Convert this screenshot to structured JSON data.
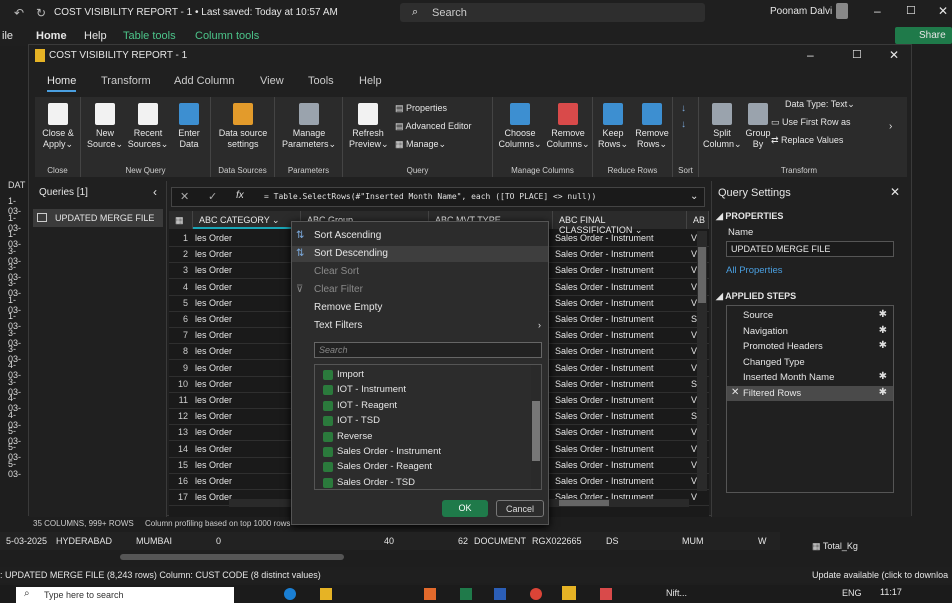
{
  "excel": {
    "title": "COST VISIBILITY REPORT - 1 • Last saved: Today at 10:57 AM",
    "search": "Search",
    "user": "Poonam Dalvi",
    "menu": [
      "ile",
      "Home",
      "Help",
      "Table tools",
      "Column tools"
    ],
    "share": "Share"
  },
  "pq": {
    "title": "COST VISIBILITY REPORT - 1",
    "tabs": [
      "Home",
      "Transform",
      "Add Column",
      "View",
      "Tools",
      "Help"
    ]
  },
  "ribbon": {
    "close": [
      "Close &",
      "Apply"
    ],
    "close_group": "Close",
    "new_source": [
      "New",
      "Source"
    ],
    "recent": [
      "Recent",
      "Sources"
    ],
    "enter": [
      "Enter",
      "Data"
    ],
    "newq_group": "New Query",
    "ds": [
      "Data source",
      "settings"
    ],
    "ds_group": "Data Sources",
    "params": [
      "Manage",
      "Parameters"
    ],
    "params_group": "Parameters",
    "refresh": [
      "Refresh",
      "Preview"
    ],
    "properties": "Properties",
    "adv": "Advanced Editor",
    "manage": "Manage",
    "query_group": "Query",
    "choose": [
      "Choose",
      "Columns"
    ],
    "remove": [
      "Remove",
      "Columns"
    ],
    "mc_group": "Manage Columns",
    "keep": [
      "Keep",
      "Rows"
    ],
    "remrows": [
      "Remove",
      "Rows"
    ],
    "rr_group": "Reduce Rows",
    "sort_group": "Sort",
    "split": [
      "Split",
      "Column"
    ],
    "group": [
      "Group",
      "By"
    ],
    "dtype": "Data Type: Text",
    "firstrow": "Use First Row as",
    "replace": "Replace Values",
    "transform_group": "Transform"
  },
  "queries": {
    "title": "Queries [1]",
    "item": "UPDATED MERGE FILE"
  },
  "formula": "= Table.SelectRows(#\"Inserted Month Name\", each ([TO PLACE] <> null))",
  "columns": {
    "category": "CATEGORY",
    "group": "Group",
    "mvt": "MVT TYPE",
    "final": "FINAL CLASSIFICATION"
  },
  "rows": [
    {
      "n": "1",
      "a": "les Order",
      "b": "Sales Order - Instrument",
      "c": "V"
    },
    {
      "n": "2",
      "a": "les Order",
      "b": "Sales Order - Instrument",
      "c": "V"
    },
    {
      "n": "3",
      "a": "les Order",
      "b": "Sales Order - Instrument",
      "c": "V"
    },
    {
      "n": "4",
      "a": "les Order",
      "b": "Sales Order - Instrument",
      "c": "V"
    },
    {
      "n": "5",
      "a": "les Order",
      "b": "Sales Order - Instrument",
      "c": "V"
    },
    {
      "n": "6",
      "a": "les Order",
      "b": "Sales Order - Instrument",
      "c": "S"
    },
    {
      "n": "7",
      "a": "les Order",
      "b": "Sales Order - Instrument",
      "c": "V"
    },
    {
      "n": "8",
      "a": "les Order",
      "b": "Sales Order - Instrument",
      "c": "V"
    },
    {
      "n": "9",
      "a": "les Order",
      "b": "Sales Order - Instrument",
      "c": "V"
    },
    {
      "n": "10",
      "a": "les Order",
      "b": "Sales Order - Instrument",
      "c": "S"
    },
    {
      "n": "11",
      "a": "les Order",
      "b": "Sales Order - Instrument",
      "c": "V"
    },
    {
      "n": "12",
      "a": "les Order",
      "b": "Sales Order - Instrument",
      "c": "S"
    },
    {
      "n": "13",
      "a": "les Order",
      "b": "Sales Order - Instrument",
      "c": "V"
    },
    {
      "n": "14",
      "a": "les Order",
      "b": "Sales Order - Instrument",
      "c": "V"
    },
    {
      "n": "15",
      "a": "les Order",
      "b": "Sales Order - Instrument",
      "c": "V"
    },
    {
      "n": "16",
      "a": "les Order",
      "b": "Sales Order - Instrument",
      "c": "V"
    },
    {
      "n": "17",
      "a": "les Order",
      "b": "Sales Order - Instrument",
      "c": "V"
    }
  ],
  "dropdown": {
    "sort_asc": "Sort Ascending",
    "sort_desc": "Sort Descending",
    "clear_sort": "Clear Sort",
    "clear_filter": "Clear Filter",
    "remove_empty": "Remove Empty",
    "text_filters": "Text Filters",
    "search": "Search",
    "values": [
      "Import",
      "IOT - Instrument",
      "IOT - Reagent",
      "IOT - TSD",
      "Reverse",
      "Sales Order - Instrument",
      "Sales Order - Reagent",
      "Sales Order - TSD"
    ],
    "ok": "OK",
    "cancel": "Cancel"
  },
  "settings": {
    "title": "Query Settings",
    "properties": "PROPERTIES",
    "name_label": "Name",
    "name": "UPDATED MERGE FILE",
    "all": "All Properties",
    "steps_title": "APPLIED STEPS",
    "steps": [
      "Source",
      "Navigation",
      "Promoted Headers",
      "Changed Type",
      "Inserted Month Name",
      "Filtered Rows"
    ]
  },
  "status": {
    "columns": "35 COLUMNS, 999+ ROWS",
    "profiling": "Column profiling based on top 1000 rows"
  },
  "excel_row": {
    "date": "5-03-2025",
    "a": "HYDERABAD",
    "b": "MUMBAI",
    "c": "0",
    "d": "40",
    "e": "62",
    "f": "DOCUMENT",
    "g": "RGX022665",
    "h": "DS",
    "i": "MUM",
    "j": "W"
  },
  "sheet": {
    "item": "Total_Kg"
  },
  "excel_status": {
    "left": ": UPDATED MERGE FILE (8,243 rows) Column: CUST CODE (8 distinct values)",
    "right": "Update available (click to downloa"
  },
  "left_dates": [
    "DAT",
    "1-03-",
    "1-03-",
    "1-03-",
    "3-03-",
    "3-03-",
    "3-03-",
    "1-03-",
    "1-03-",
    "3-03-",
    "3-03-",
    "4-03-",
    "3-03-",
    "4-03-",
    "4-03-",
    "5-03-",
    "5-03-",
    "5-03-"
  ],
  "taskbar": {
    "search": "Type here to search",
    "nift": "Nift...",
    "lang": "ENG",
    "time": "11:17"
  }
}
